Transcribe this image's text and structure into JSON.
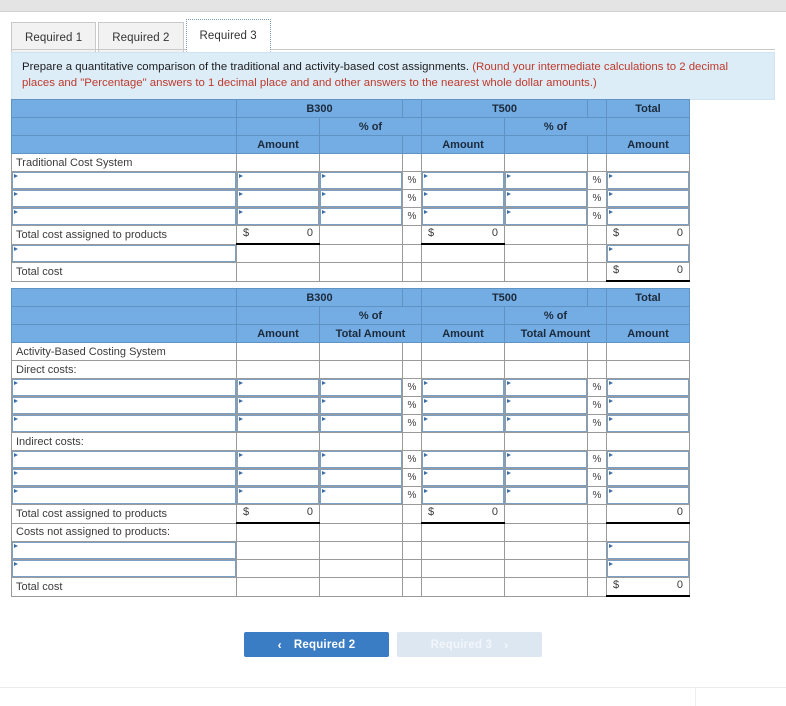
{
  "tabs": [
    {
      "label": "Required 1",
      "active": false
    },
    {
      "label": "Required 2",
      "active": false
    },
    {
      "label": "Required 3",
      "active": true
    }
  ],
  "instruction": {
    "main": "Prepare a quantitative comparison of the traditional and activity-based cost assignments.",
    "hint": "(Round your intermediate calculations to 2 decimal places and \"Percentage\" answers to 1 decimal place and and other answers to the nearest whole dollar amounts.)"
  },
  "table1": {
    "headers": {
      "product_1": "B300",
      "product_2": "T500",
      "total": "Total",
      "pct_of": "% of",
      "amount": "Amount"
    },
    "rows": [
      {
        "type": "section",
        "label": "Traditional Cost System"
      },
      {
        "type": "input_pct",
        "label": ""
      },
      {
        "type": "input_pct",
        "label": ""
      },
      {
        "type": "input_pct",
        "label": ""
      },
      {
        "type": "total_money",
        "label": "Total cost assigned to products",
        "b300_cur": "$",
        "b300_val": "0",
        "t500_cur": "$",
        "t500_val": "0",
        "total_cur": "$",
        "total_val": "0"
      },
      {
        "type": "input_total_only",
        "label": ""
      },
      {
        "type": "grand_total",
        "label": "Total cost",
        "total_cur": "$",
        "total_val": "0"
      }
    ]
  },
  "table2": {
    "headers": {
      "product_1": "B300",
      "product_2": "T500",
      "total": "Total",
      "pct_of": "% of",
      "amount": "Amount",
      "total_amount": "Total Amount"
    },
    "rows": [
      {
        "type": "section",
        "label": "Activity-Based Costing System"
      },
      {
        "type": "section",
        "label": "Direct costs:"
      },
      {
        "type": "input_pct",
        "label": ""
      },
      {
        "type": "input_pct",
        "label": ""
      },
      {
        "type": "input_pct",
        "label": ""
      },
      {
        "type": "section",
        "label": "Indirect costs:"
      },
      {
        "type": "input_pct",
        "label": ""
      },
      {
        "type": "input_pct",
        "label": ""
      },
      {
        "type": "input_pct",
        "label": ""
      },
      {
        "type": "total_money_nodollar",
        "label": "Total cost assigned to products",
        "b300_cur": "$",
        "b300_val": "0",
        "t500_cur": "$",
        "t500_val": "0",
        "total_cur": "",
        "total_val": "0"
      },
      {
        "type": "section",
        "label": "Costs not assigned to products:"
      },
      {
        "type": "input_total_only",
        "label": ""
      },
      {
        "type": "input_total_only",
        "label": ""
      },
      {
        "type": "grand_total",
        "label": "Total cost",
        "total_cur": "$",
        "total_val": "0"
      }
    ]
  },
  "nav": {
    "prev_label": "Required 2",
    "next_label": "Required 3",
    "prev_chevron": "‹",
    "next_chevron": "›",
    "primary_color": "#3b7dc4",
    "disabled_color": "#dce7f2"
  }
}
